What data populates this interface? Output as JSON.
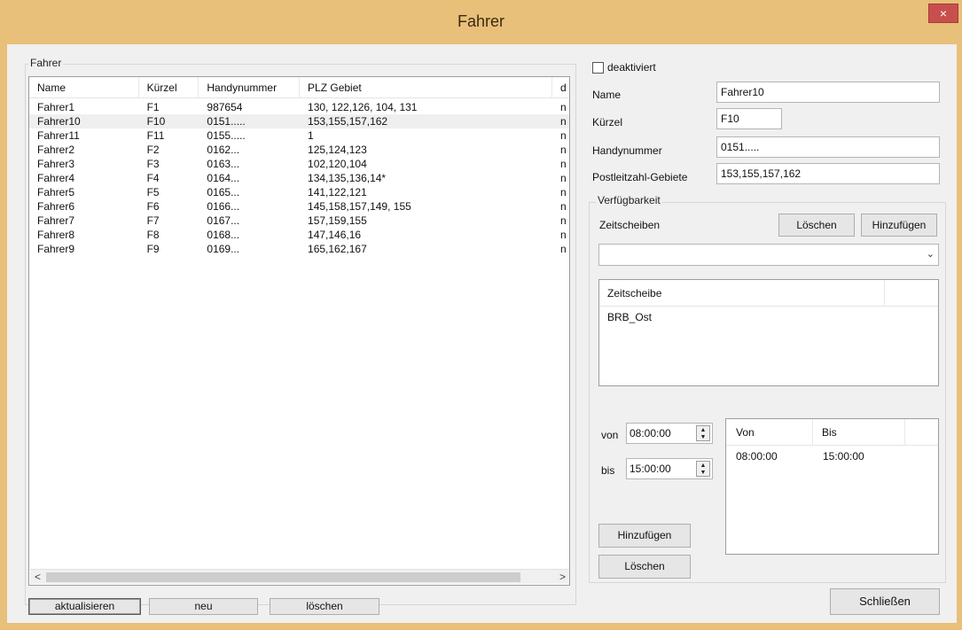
{
  "window": {
    "title": "Fahrer",
    "close_symbol": "×"
  },
  "left": {
    "group_title": "Fahrer",
    "columns": [
      "Name",
      "Kürzel",
      "Handynummer",
      "PLZ Gebiet",
      "d"
    ],
    "rows": [
      [
        "Fahrer1",
        "F1",
        "987654",
        "130, 122,126, 104, 131",
        "n"
      ],
      [
        "Fahrer10",
        "F10",
        "0151.....",
        "153,155,157,162",
        "n"
      ],
      [
        "Fahrer11",
        "F11",
        "0155.....",
        "1",
        "n"
      ],
      [
        "Fahrer2",
        "F2",
        "0162...",
        "125,124,123",
        "n"
      ],
      [
        "Fahrer3",
        "F3",
        "0163...",
        "102,120,104",
        "n"
      ],
      [
        "Fahrer4",
        "F4",
        "0164...",
        "134,135,136,14*",
        "n"
      ],
      [
        "Fahrer5",
        "F5",
        "0165...",
        "141,122,121",
        "n"
      ],
      [
        "Fahrer6",
        "F6",
        "0166...",
        "145,158,157,149, 155",
        "n"
      ],
      [
        "Fahrer7",
        "F7",
        "0167...",
        "157,159,155",
        "n"
      ],
      [
        "Fahrer8",
        "F8",
        "0168...",
        "147,146,16",
        "n"
      ],
      [
        "Fahrer9",
        "F9",
        "0169...",
        "165,162,167",
        "n"
      ]
    ],
    "selected_row": 1,
    "scroll_left_symbol": "<",
    "scroll_right_symbol": ">",
    "buttons": {
      "refresh": "aktualisieren",
      "new": "neu",
      "delete": "löschen"
    }
  },
  "right": {
    "deactivated_label": "deaktiviert",
    "deactivated_checked": false,
    "fields": {
      "name_label": "Name",
      "name_value": "Fahrer10",
      "short_label": "Kürzel",
      "short_value": "F10",
      "phone_label": "Handynummer",
      "phone_value": "0151.....",
      "plz_label": "Postleitzahl-Gebiete",
      "plz_value": "153,155,157,162"
    },
    "availability": {
      "group_title": "Verfügbarkeit",
      "slices_label": "Zeitscheiben",
      "delete_label": "Löschen",
      "add_label": "Hinzufügen",
      "combo_value": "",
      "combo_arrow": "⌄",
      "slices_header": "Zeitscheibe",
      "slices": [
        "BRB_Ost"
      ],
      "from_label": "von",
      "from_value": "08:00:00",
      "to_label": "bis",
      "to_value": "15:00:00",
      "time_add_label": "Hinzufügen",
      "time_delete_label": "Löschen",
      "times_columns": [
        "Von",
        "Bis"
      ],
      "times_rows": [
        [
          "08:00:00",
          "15:00:00"
        ]
      ]
    },
    "close_label": "Schließen"
  }
}
